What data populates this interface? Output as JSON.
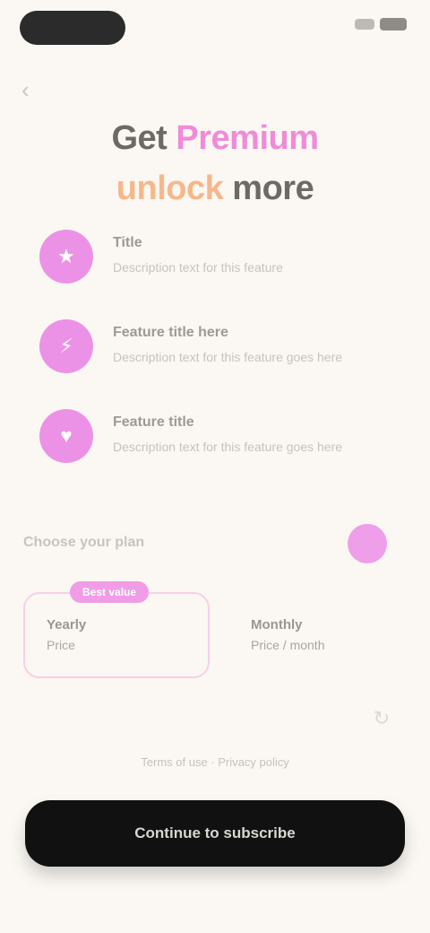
{
  "headline": {
    "line1_dark": "Get",
    "line1_accent": " Premium",
    "line2_accent": "unlock ",
    "line2_dark": "more"
  },
  "features": [
    {
      "icon": "star-icon",
      "title": "Title",
      "desc": "Description text for this feature"
    },
    {
      "icon": "bolt-icon",
      "title": "Feature title here",
      "desc": "Description text for this feature goes here"
    },
    {
      "icon": "heart-icon",
      "title": "Feature title",
      "desc": "Description text for this feature goes here"
    }
  ],
  "plans_section": {
    "label": "Choose your plan"
  },
  "plans": {
    "yearly": {
      "badge": "Best value",
      "name": "Yearly",
      "price": "Price"
    },
    "monthly": {
      "name": "Monthly",
      "price": "Price / month"
    }
  },
  "footer": {
    "terms": "Terms of use · Privacy policy",
    "cta": "Continue to subscribe"
  },
  "colors": {
    "accent_pink": "#ec92e6",
    "accent_orange": "#f7b78a",
    "background": "#fbf8f3",
    "cta_background": "#111111"
  }
}
